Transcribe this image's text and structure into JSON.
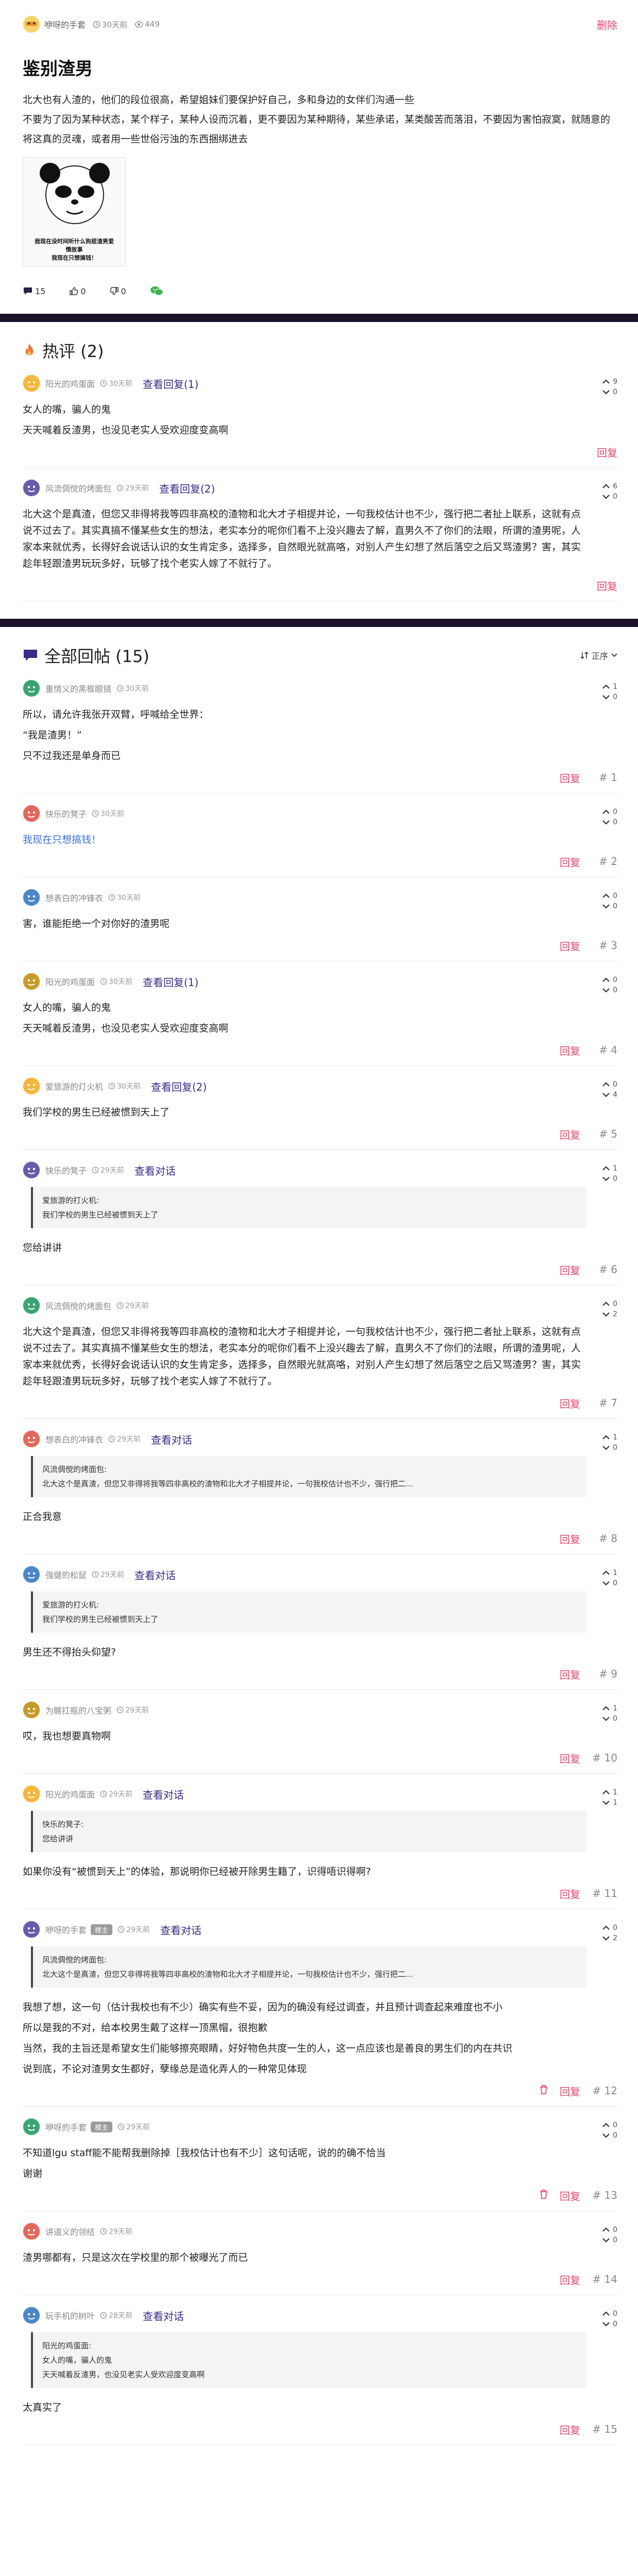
{
  "post": {
    "author": "咿呀的手套",
    "time": "30天前",
    "views": "449",
    "delete_label": "删除",
    "title": "鉴别渣男",
    "body": [
      "北大也有人渣的，他们的段位很高，希望姐妹们要保护好自己，多和身边的女伴们沟通一些",
      "不要为了因为某种状态，某个样子，某种人设而沉着，更不要因为某种期待，某些承诺，某类酸苦而落泪，不要因为害怕寂寞，就随意的将这真的灵魂，或者用一些世俗污浊的东西捆绑进去"
    ],
    "meme": {
      "line1": "我现在没时间听什么狗屁渣男爱情故事",
      "line2": "我现在只想搞钱！"
    },
    "actions": {
      "comments": "15",
      "likes": "0",
      "dislikes": "0"
    }
  },
  "hot": {
    "title": "热评 (2)",
    "items": [
      {
        "name": "阳光的鸡蛋面",
        "time": "30天前",
        "link": "查看回复(1)",
        "up": "9",
        "down": "0",
        "body": [
          "女人的嘴，骗人的鬼",
          "天天喊着反渣男，也没见老实人受欢迎度变高啊"
        ],
        "reply": "回复"
      },
      {
        "name": "风流倜傥的烤面包",
        "time": "29天前",
        "link": "查看回复(2)",
        "up": "6",
        "down": "0",
        "body": [
          "北大这个是真渣，但您又非得将我等四非高校的渣物和北大才子相提并论，一句我校估计也不少，强行把二者扯上联系，这就有点说不过去了。其实真搞不懂某些女生的想法，老实本分的呢你们看不上没兴趣去了解，直男久不了你们的法眼，所谓的渣男呢，人家本来就优秀，长得好会说话认识的女生肯定多，选择多，自然眼光就高咯，对别人产生幻想了然后落空之后又骂渣男？害，其实趁年轻跟渣男玩玩多好，玩够了找个老实人嫁了不就行了。"
        ],
        "reply": "回复"
      }
    ]
  },
  "all": {
    "title": "全部回帖 (15)",
    "sort": "正序",
    "items": [
      {
        "name": "重情义的黑框眼镜",
        "time": "30天前",
        "up": "1",
        "down": "0",
        "body": [
          "所以，请允许我张开双臂，呼喊给全世界：",
          "“我是渣男！”",
          "只不过我还是单身而已"
        ],
        "reply": "回复",
        "floor": "# 1"
      },
      {
        "name": "快乐的凳子",
        "time": "30天前",
        "up": "0",
        "down": "0",
        "body": [
          "我现在只想搞钱！"
        ],
        "blue": true,
        "reply": "回复",
        "floor": "# 2"
      },
      {
        "name": "想表白的冲锋衣",
        "time": "30天前",
        "up": "0",
        "down": "0",
        "body": [
          "害，谁能拒绝一个对你好的渣男呢"
        ],
        "reply": "回复",
        "floor": "# 3"
      },
      {
        "name": "阳光的鸡蛋面",
        "time": "30天前",
        "link": "查看回复(1)",
        "up": "0",
        "down": "0",
        "body": [
          "女人的嘴，骗人的鬼",
          "天天喊着反渣男，也没见老实人受欢迎度变高啊"
        ],
        "reply": "回复",
        "floor": "# 4"
      },
      {
        "name": "爱旅游的灯火机",
        "time": "30天前",
        "link": "查看回复(2)",
        "up": "0",
        "down": "4",
        "body": [
          "我们学校的男生已经被惯到天上了"
        ],
        "reply": "回复",
        "floor": "# 5"
      },
      {
        "name": "快乐的凳子",
        "time": "29天前",
        "link": "查看对话",
        "up": "1",
        "down": "0",
        "quote": [
          "爱旅游的打火机:",
          "我们学校的男生已经被惯到天上了"
        ],
        "body": [
          "您给讲讲"
        ],
        "reply": "回复",
        "floor": "# 6"
      },
      {
        "name": "风流倜傥的烤面包",
        "time": "29天前",
        "up": "0",
        "down": "2",
        "body": [
          "北大这个是真渣，但您又非得将我等四非高校的渣物和北大才子相提并论，一句我校估计也不少，强行把二者扯上联系，这就有点说不过去了。其实真搞不懂某些女生的想法，老实本分的呢你们看不上没兴趣去了解，直男久不了你们的法眼，所谓的渣男呢，人家本来就优秀，长得好会说话认识的女生肯定多，选择多，自然眼光就高咯，对别人产生幻想了然后落空之后又骂渣男？害，其实趁年轻跟渣男玩玩多好，玩够了找个老实人嫁了不就行了。"
        ],
        "reply": "回复",
        "floor": "# 7"
      },
      {
        "name": "想表白的冲锋衣",
        "time": "29天前",
        "link": "查看对话",
        "up": "1",
        "down": "0",
        "quote": [
          "风流倜傥的烤面包:",
          "北大这个是真渣，但您又非得将我等四非高校的渣物和北大才子相提并论，一句我校估计也不少，强行把二..."
        ],
        "body": [
          "正合我意"
        ],
        "reply": "回复",
        "floor": "# 8"
      },
      {
        "name": "强健的松鼠",
        "time": "29天前",
        "link": "查看对话",
        "up": "1",
        "down": "0",
        "quote": [
          "爱旅游的打火机:",
          "我们学校的男生已经被惯到天上了"
        ],
        "body": [
          "男生还不得抬头仰望?"
        ],
        "reply": "回复",
        "floor": "# 9"
      },
      {
        "name": "为髂扛瓶的八宝粥",
        "time": "29天前",
        "up": "1",
        "down": "0",
        "body": [
          "哎，我也想要真物啊"
        ],
        "reply": "回复",
        "floor": "# 10"
      },
      {
        "name": "阳光的鸡蛋面",
        "time": "29天前",
        "link": "查看对话",
        "up": "1",
        "down": "1",
        "quote": [
          "快乐的凳子:",
          "您给讲讲"
        ],
        "body": [
          "如果你没有“被惯到天上”的体验，那说明你已经被开除男生籍了，识得唔识得啊?"
        ],
        "reply": "回复",
        "floor": "# 11"
      },
      {
        "name": "咿呀的手套",
        "badge": "楼主",
        "time": "29天前",
        "link": "查看对话",
        "up": "0",
        "down": "2",
        "quote": [
          "风流倜傥的烤面包:",
          "北大这个是真渣，但您又非得将我等四非高校的渣物和北大才子相提并论，一句我校估计也不少，强行把二..."
        ],
        "body": [
          "我想了想，这一句（估计我校也有不少）确实有些不妥，因为的确没有经过调查，并且预计调查起来难度也不小",
          "所以是我的不对，给本校男生戴了这样一顶黑帽，很抱歉",
          "当然，我的主旨还是希望女生们能够擦亮眼睛，好好物色共度一生的人，这一点应该也是善良的男生们的内在共识",
          "说到底，不论对渣男女生都好，孽缘总是造化弄人的一种常见体现"
        ],
        "trash": true,
        "reply": "回复",
        "floor": "# 12"
      },
      {
        "name": "咿呀的手套",
        "badge": "楼主",
        "time": "29天前",
        "up": "0",
        "down": "0",
        "body": [
          "不知道lgu staff能不能帮我删除掉［我校估计也有不少］这句话呢，说的的确不恰当",
          "谢谢"
        ],
        "trash": true,
        "reply": "回复",
        "floor": "# 13"
      },
      {
        "name": "讲道义的领结",
        "time": "29天前",
        "up": "0",
        "down": "0",
        "body": [
          "渣男哪都有，只是这次在学校里的那个被曝光了而已"
        ],
        "reply": "回复",
        "floor": "# 14"
      },
      {
        "name": "玩手机的树叶",
        "time": "28天前",
        "link": "查看对话",
        "up": "0",
        "down": "0",
        "quote": [
          "阳光的鸡蛋面:",
          "女人的嘴，骗人的鬼",
          "天天喊着反渣男，也没见老实人受欢迎度变高啊"
        ],
        "body": [
          "太真实了"
        ],
        "reply": "回复",
        "floor": "# 15"
      }
    ]
  },
  "icons": {
    "eye": "eye-icon",
    "clock": "clock-icon",
    "comment": "comment-icon",
    "like": "thumb-up-icon",
    "dislike": "thumb-down-icon",
    "wechat": "wechat-icon",
    "fire": "fire-icon",
    "speech": "speech-bubble-icon",
    "sort": "sort-icon",
    "up": "chevron-up-icon",
    "down": "chevron-down-icon",
    "trash": "trash-icon"
  },
  "colors": {
    "accent": "#e0486b",
    "link": "#3b2a86",
    "divider": "#1c1329",
    "blue_text": "#3b6fd6"
  }
}
